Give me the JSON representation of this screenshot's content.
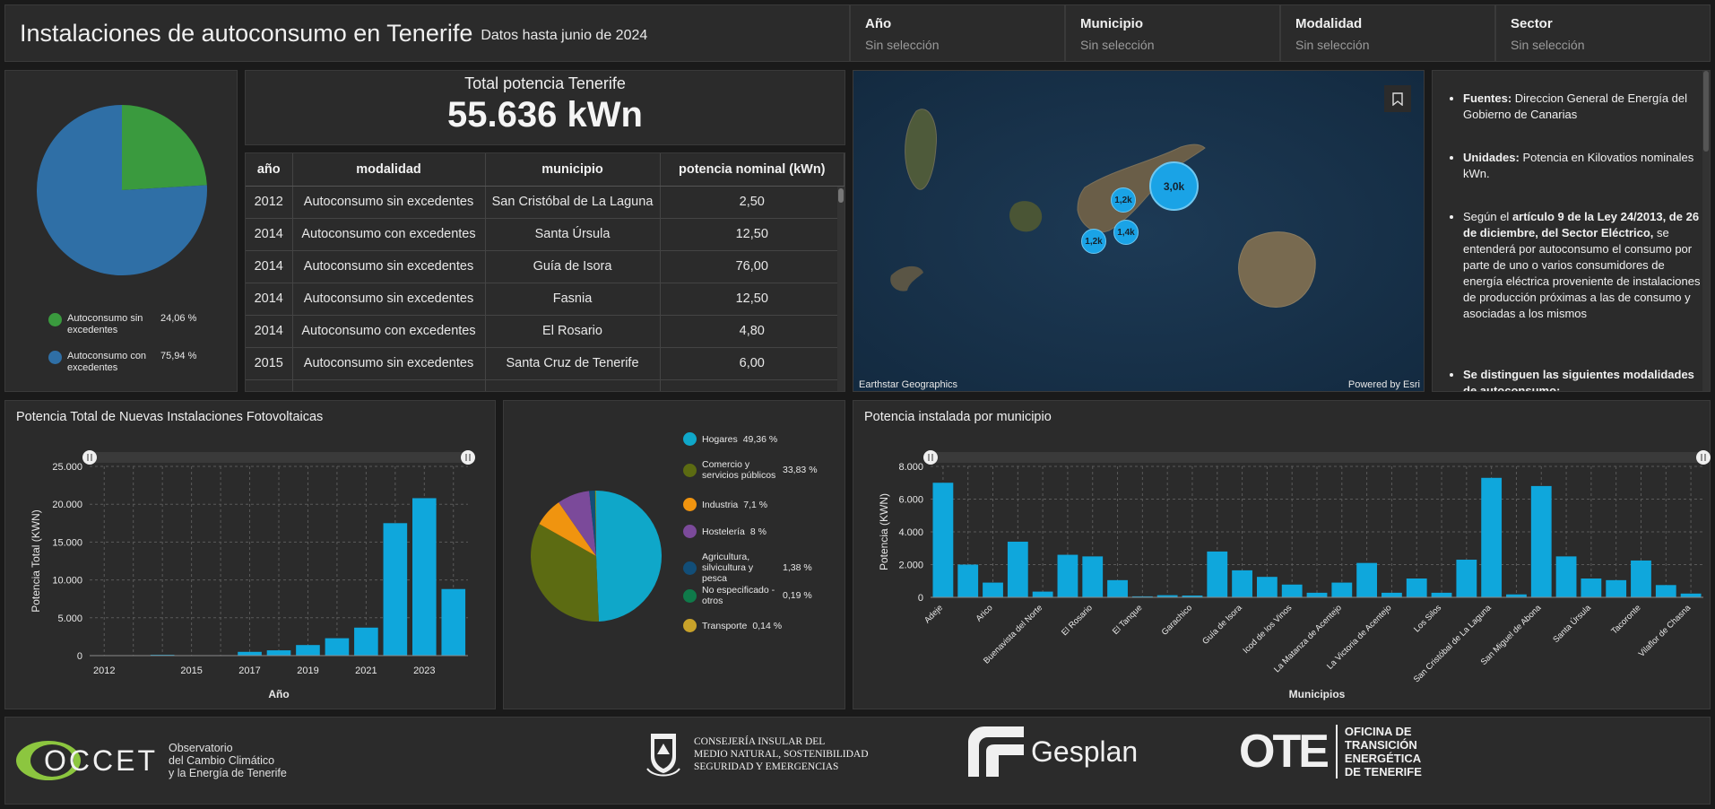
{
  "header": {
    "title": "Instalaciones de autoconsumo en Tenerife",
    "subtitle": "Datos hasta junio de 2024"
  },
  "filters": [
    {
      "label": "Año",
      "value": "Sin selección"
    },
    {
      "label": "Municipio",
      "value": "Sin selección"
    },
    {
      "label": "Modalidad",
      "value": "Sin selección"
    },
    {
      "label": "Sector",
      "value": "Sin selección"
    }
  ],
  "modalidad_pie": {
    "items": [
      {
        "label": "Autoconsumo sin excedentes",
        "pct": "24,06 %",
        "value": 24.06,
        "color": "#3a9a3e"
      },
      {
        "label": "Autoconsumo con excedentes",
        "pct": "75,94 %",
        "value": 75.94,
        "color": "#2f6fa6"
      }
    ]
  },
  "kpi": {
    "title": "Total potencia Tenerife",
    "value": "55.636 kWn"
  },
  "table": {
    "headers": [
      "año",
      "modalidad",
      "municipio",
      "potencia nominal (kWn)"
    ],
    "rows": [
      [
        "2012",
        "Autoconsumo sin excedentes",
        "San Cristóbal de La Laguna",
        "2,50"
      ],
      [
        "2014",
        "Autoconsumo con excedentes",
        "Santa Úrsula",
        "12,50"
      ],
      [
        "2014",
        "Autoconsumo sin excedentes",
        "Guía de Isora",
        "76,00"
      ],
      [
        "2014",
        "Autoconsumo sin excedentes",
        "Fasnia",
        "12,50"
      ],
      [
        "2014",
        "Autoconsumo con excedentes",
        "El Rosario",
        "4,80"
      ],
      [
        "2015",
        "Autoconsumo sin excedentes",
        "Santa Cruz de Tenerife",
        "6,00"
      ]
    ]
  },
  "map": {
    "attribution_left": "Earthstar Geographics",
    "attribution_right": "Powered by Esri",
    "clusters": [
      "3,0k",
      "1,2k",
      "1,4k",
      "1,2k"
    ]
  },
  "info": {
    "items": [
      {
        "bold": "Fuentes:",
        "text": " Direccion General de Energía del Gobierno de Canarias"
      },
      {
        "bold": "Unidades:",
        "text": " Potencia en Kilovatios nominales kWn."
      },
      {
        "pre": "Según el ",
        "bold": "artículo 9 de la Ley 24/2013, de 26 de diciembre, del Sector Eléctrico,",
        "text": " se entenderá por autoconsumo el consumo por parte de uno o varios consumidores de energía eléctrica proveniente de instalaciones de producción próximas a las de consumo y asociadas a los mismos"
      },
      {
        "text": "Se distinguen las siguientes modalidades de autoconsumo:"
      }
    ]
  },
  "bar_year_title": "Potencia Total de Nuevas Instalaciones Fotovoltaicas",
  "sector_pie": {
    "items": [
      {
        "label": "Hogares",
        "pct": "49,36 %",
        "value": 49.36,
        "color": "#0fa7c9"
      },
      {
        "label": "Comercio y servicios públicos",
        "pct": "33,83 %",
        "value": 33.83,
        "color": "#5c6b12"
      },
      {
        "label": "Industria",
        "pct": "7,1 %",
        "value": 7.1,
        "color": "#f0940f"
      },
      {
        "label": "Hostelería",
        "pct": "8 %",
        "value": 8.0,
        "color": "#7b4a9a"
      },
      {
        "label": "Agricultura, silvicultura y pesca",
        "pct": "1,38 %",
        "value": 1.38,
        "color": "#124e78"
      },
      {
        "label": "No especificado - otros",
        "pct": "0,19 %",
        "value": 0.19,
        "color": "#0f7a4a"
      },
      {
        "label": "Transporte",
        "pct": "0,14 %",
        "value": 0.14,
        "color": "#c8a22a"
      }
    ]
  },
  "bar_muni_title": "Potencia instalada por municipio",
  "chart_data": [
    {
      "type": "bar",
      "title": "Potencia Total de Nuevas Instalaciones Fotovoltaicas",
      "xlabel": "Año",
      "ylabel": "Potencia Total (KWN)",
      "categories": [
        "2012",
        "2013",
        "2014",
        "2015",
        "2016",
        "2017",
        "2018",
        "2019",
        "2020",
        "2021",
        "2022",
        "2023",
        "2024"
      ],
      "tick_labels": [
        "2012",
        "2015",
        "2017",
        "2019",
        "2021",
        "2023"
      ],
      "values": [
        20,
        30,
        110,
        40,
        60,
        500,
        700,
        1400,
        2300,
        3700,
        17500,
        20800,
        8800
      ],
      "ylim": [
        0,
        25000
      ],
      "yticks": [
        "0",
        "5.000",
        "10.000",
        "15.000",
        "20.000",
        "25.000"
      ],
      "color": "#0fa7dc",
      "grid": true
    },
    {
      "type": "bar",
      "title": "Potencia instalada por municipio",
      "xlabel": "Municipios",
      "ylabel": "Potencia (KWN)",
      "categories": [
        "Adeje",
        "Arafo",
        "Arico",
        "Arona",
        "Buenavista del Norte",
        "Candelaria",
        "El Rosario",
        "El Sauzal",
        "El Tanque",
        "Fasnia",
        "Garachico",
        "Granadilla de Abona",
        "Guía de Isora",
        "Güímar",
        "Icod de los Vinos",
        "La Guancha",
        "La Matanza de Acentejo",
        "La Orotava",
        "La Victoria de Acentejo",
        "Los Realejos",
        "Los Silos",
        "Puerto de la Cruz",
        "San Cristóbal de La Laguna",
        "San Juan de la Rambla",
        "San Miguel de Abona",
        "Santa Cruz de Tenerife",
        "Santa Úrsula",
        "Santiago del Teide",
        "Tacoronte",
        "Tegueste",
        "Vilaflor de Chasna"
      ],
      "tick_labels": [
        "Adeje",
        "Arico",
        "Buenavista del Norte",
        "El Rosario",
        "El Tanque",
        "Garachico",
        "Guía de Isora",
        "Icod de los Vinos",
        "La Matanza de Acentejo",
        "La Victoria de Acentejo",
        "Los Silos",
        "San Cristóbal de La Laguna",
        "San Miguel de Abona",
        "Santa Úrsula",
        "Tacoronte",
        "Vilaflor de Chasna"
      ],
      "values": [
        7000,
        2000,
        900,
        3400,
        350,
        2600,
        2500,
        1050,
        60,
        130,
        110,
        2800,
        1650,
        1250,
        780,
        280,
        900,
        2100,
        280,
        1150,
        280,
        2300,
        7300,
        180,
        6800,
        2500,
        1150,
        1050,
        2250,
        750,
        230
      ],
      "ylim": [
        0,
        8000
      ],
      "yticks": [
        "0",
        "2.000",
        "4.000",
        "6.000",
        "8.000"
      ],
      "color": "#0fa7dc",
      "grid": true
    }
  ],
  "footer": {
    "occet_name": "OCCET",
    "occet_lines": [
      "Observatorio",
      "del Cambio Climático",
      "y la Energía de Tenerife"
    ],
    "cabildo_seal": "CABILDO DE TENERIFE",
    "cabildo_lines": [
      "CONSEJERÍA INSULAR DEL",
      "MEDIO NATURAL, SOSTENIBILIDAD",
      "SEGURIDAD Y EMERGENCIAS"
    ],
    "gesplan": "Gesplan",
    "ote_mark": "OTE",
    "ote_lines": [
      "OFICINA DE",
      "TRANSICIÓN",
      "ENERGÉTICA",
      "DE TENERIFE"
    ]
  }
}
